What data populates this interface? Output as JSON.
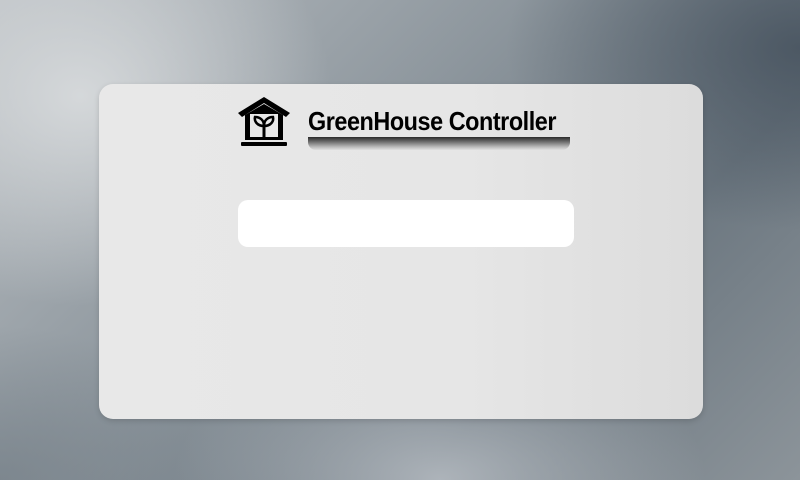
{
  "app": {
    "title": "GreenHouse Controller",
    "logo_icon": "greenhouse-sprout-icon"
  },
  "main": {
    "input": {
      "value": "",
      "placeholder": ""
    }
  },
  "colors": {
    "card_background": "#e8e8e8",
    "input_background": "#ffffff",
    "title_text": "#000000"
  }
}
